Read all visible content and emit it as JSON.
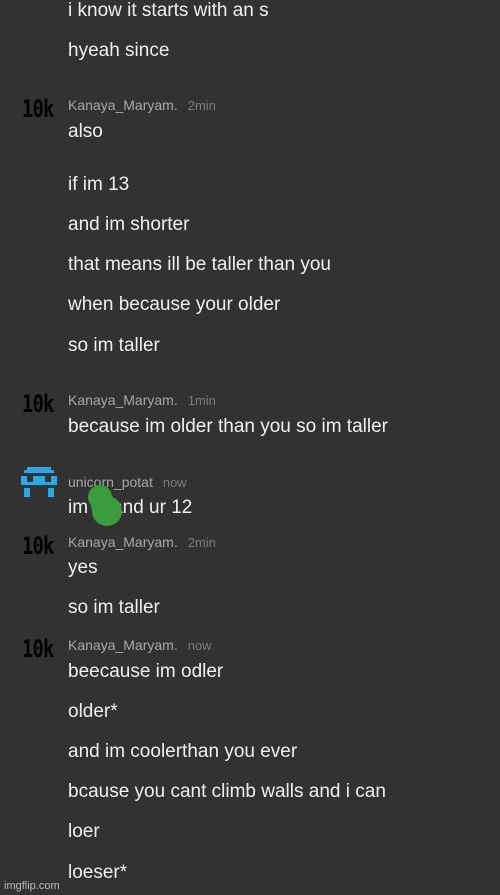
{
  "messages": {
    "top_lines": [
      "i know it starts with an s",
      "hyeah since"
    ],
    "m1": {
      "avatar": "10k",
      "user": "Kanaya_Maryam.",
      "time": "2min",
      "lines": [
        "also",
        "if im 13",
        "and im shorter",
        "that means ill be taller than you",
        "when because your older",
        "so im taller"
      ]
    },
    "m2": {
      "avatar": "10k",
      "user": "Kanaya_Maryam.",
      "time": "1min",
      "lines": [
        "because im older than you so im taller"
      ]
    },
    "m3": {
      "avatar_icon": "pixel-creature-icon",
      "user": "unicorn_potat",
      "time": "now",
      "line_a": "im",
      "line_b": "and ur 12"
    },
    "m4": {
      "avatar": "10k",
      "user": "Kanaya_Maryam.",
      "time": "2min",
      "lines": [
        "yes",
        "so im taller"
      ]
    },
    "m5": {
      "avatar": "10k",
      "user": "Kanaya_Maryam.",
      "time": "now",
      "lines": [
        "beecause im odler",
        "older*",
        "and im coolerthan you ever",
        "bcause you cant climb walls and i can",
        "loer",
        "loeser*"
      ]
    }
  },
  "watermark": "imgflip.com",
  "colors": {
    "background": "#323232",
    "username": "#a8a8a8",
    "timestamp": "#7b7b7b",
    "pixel_avatar": "#2fa8e0",
    "scribble": "#3c9b3c"
  }
}
